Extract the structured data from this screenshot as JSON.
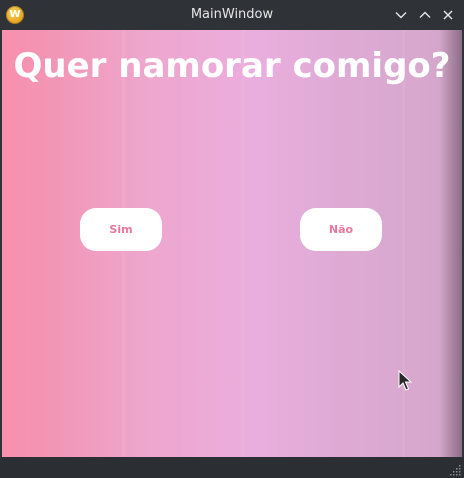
{
  "window": {
    "title": "MainWindow",
    "app_icon_letter": "W"
  },
  "titlebar": {
    "buttons": {
      "minimize": "chevron-down-icon",
      "maximize": "chevron-up-icon",
      "close": "close-icon"
    }
  },
  "main": {
    "heading": "Quer namorar comigo?",
    "yes_label": "Sim",
    "no_label": "Não"
  },
  "colors": {
    "titlebar_bg": "#2f3237",
    "gradient_left": "#f98fae",
    "gradient_mid": "#eaaede",
    "gradient_right": "#d6a7cc",
    "button_bg": "#ffffff",
    "button_text": "#e8789a",
    "heading_text": "#ffffff"
  }
}
